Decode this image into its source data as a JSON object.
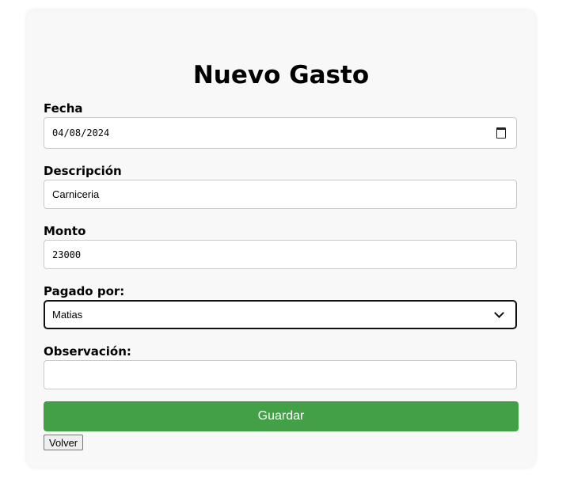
{
  "form": {
    "title": "Nuevo Gasto",
    "fecha": {
      "label": "Fecha",
      "value": "04/08/2024"
    },
    "descripcion": {
      "label": "Descripción",
      "value": "Carniceria"
    },
    "monto": {
      "label": "Monto",
      "value": "23000"
    },
    "pagado_por": {
      "label": "Pagado por:",
      "selected": "Matias"
    },
    "observacion": {
      "label": "Observación:",
      "value": ""
    },
    "save_label": "Guardar",
    "back_label": "Volver"
  },
  "colors": {
    "save_button": "#43a047",
    "card_background": "#f8f8f8"
  },
  "icons": {
    "date_picker": "calendar-icon",
    "select": "chevron-down-icon"
  }
}
